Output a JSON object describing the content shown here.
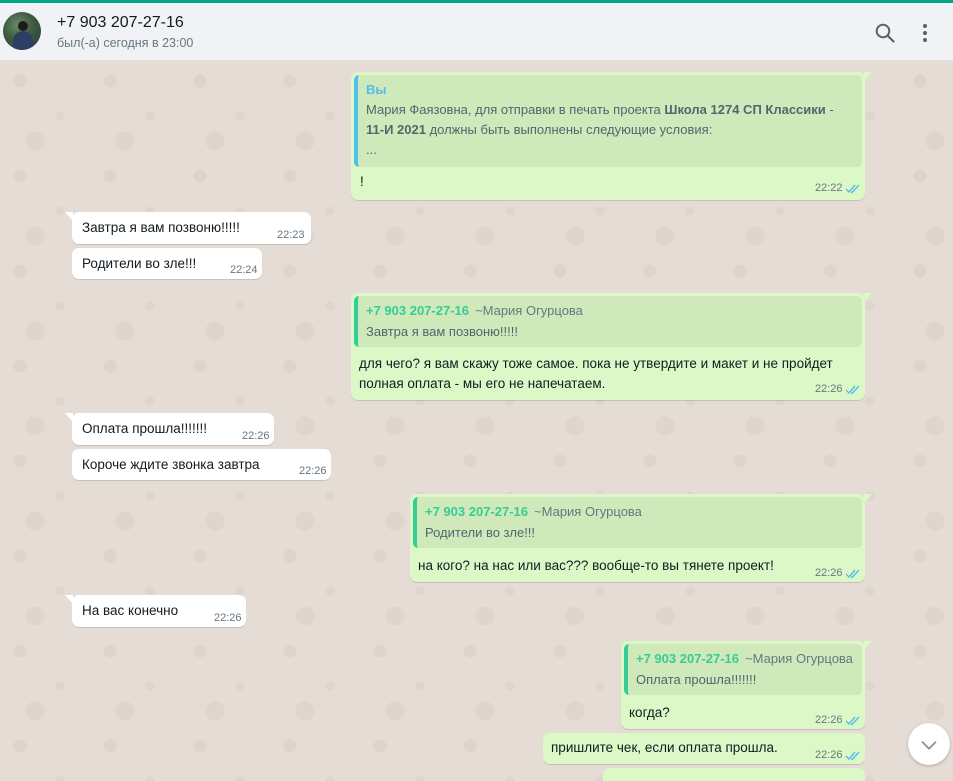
{
  "header": {
    "name": "+7 903 207-27-16",
    "status": "был(-а) сегодня в 23:00",
    "icons": [
      "avatar",
      "search-icon",
      "menu-icon"
    ]
  },
  "messages": {
    "m1": {
      "quote_author": "Вы",
      "quote_line1": "Мария  Фаязовна, для отправки в печать проекта ",
      "quote_line1_bold": "Школа  1274 СП Классики",
      "quote_line1_end": " -",
      "quote_line2_bold": "11-И 2021",
      "quote_line2": " должны быть выполнены следующие условия:",
      "quote_line3": "...",
      "text": "!",
      "time": "22:22"
    },
    "m2": {
      "text": "Завтра я вам позвоню!!!!!",
      "time": "22:23"
    },
    "m3": {
      "text": "Родители во зле!!!",
      "time": "22:24"
    },
    "m4": {
      "quote_author": "+7 903 207-27-16",
      "quote_alias": "~Мария Огурцова",
      "quote_text": "Завтра я вам позвоню!!!!!",
      "text_line1": "для чего? я вам скажу тоже самое. пока не утвердите и макет и не пройдет",
      "text_line2": "полная оплата - мы его не напечатаем.",
      "time": "22:26"
    },
    "m5": {
      "text": "Оплата прошла!!!!!!!",
      "time": "22:26"
    },
    "m6": {
      "text": "Короче ждите звонка завтра",
      "time": "22:26"
    },
    "m7": {
      "quote_author": "+7 903 207-27-16",
      "quote_alias": "~Мария Огурцова",
      "quote_text": "Родители во зле!!!",
      "text": "на кого? на нас или вас??? вообще-то вы тянете проект!",
      "time": "22:26"
    },
    "m8": {
      "text": "На вас конечно",
      "time": "22:26"
    },
    "m9": {
      "quote_author": "+7 903 207-27-16",
      "quote_alias": "~Мария Огурцова",
      "quote_text": "Оплата прошла!!!!!!!",
      "text": "когда?",
      "time": "22:26"
    },
    "m10": {
      "text": "пришлите чек, если оплата прошла.",
      "time": "22:26"
    }
  },
  "colors": {
    "accent": "#00a884",
    "outgoing": "#dcf8c6",
    "incoming": "#ffffff",
    "read_ticks": "#53bdeb",
    "quote_author_green": "#35cd96",
    "background": "#e5ddd5"
  }
}
